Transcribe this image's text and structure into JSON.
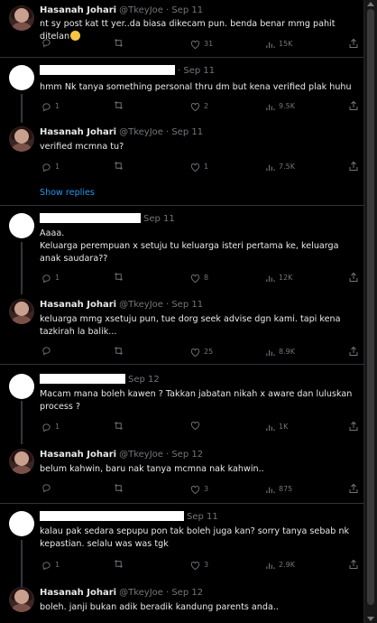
{
  "tweets": [
    {
      "name": "Hasanah Johari",
      "handle": "@TkeyJoe",
      "date": "Sep 11",
      "text": "nt sy post kat tt yer..da biasa dikecam pun. benda benar mmg pahit ditelan",
      "replies": "",
      "retweets": "",
      "likes": "31",
      "views": "15K"
    },
    {
      "name": "",
      "handle": "",
      "date": "Sep 11",
      "text": "hmm Nk tanya something personal  thru dm but kena verified plak huhu",
      "replies": "1",
      "retweets": "",
      "likes": "2",
      "views": "9.5K"
    },
    {
      "name": "Hasanah Johari",
      "handle": "@TkeyJoe",
      "date": "Sep 11",
      "text": "verified mcmna tu?",
      "replies": "1",
      "retweets": "",
      "likes": "1",
      "views": "7.5K"
    },
    {
      "name": "",
      "handle": "",
      "date": "Sep 11",
      "text": "Aaaa.\nKeluarga perempuan x setuju tu keluarga isteri pertama ke, keluarga anak saudara??",
      "replies": "1",
      "retweets": "",
      "likes": "8",
      "views": "12K"
    },
    {
      "name": "Hasanah Johari",
      "handle": "@TkeyJoe",
      "date": "Sep 11",
      "text": "keluarga mmg xsetuju pun, tue dorg seek advise dgn kami. tapi kena tazkirah la balik...",
      "replies": "",
      "retweets": "",
      "likes": "25",
      "views": "8.9K"
    },
    {
      "name": "",
      "handle": "",
      "date": "Sep 12",
      "text": "Macam mana boleh kawen ? Takkan jabatan nikah x aware dan luluskan process ?",
      "replies": "1",
      "retweets": "",
      "likes": "",
      "views": "1K"
    },
    {
      "name": "Hasanah Johari",
      "handle": "@TkeyJoe",
      "date": "Sep 12",
      "text": "belum kahwin, baru nak tanya mcmna nak kahwin..",
      "replies": "",
      "retweets": "",
      "likes": "3",
      "views": "875"
    },
    {
      "name": "",
      "handle": "",
      "date": "Sep 11",
      "text": "kalau pak sedara sepupu pon tak boleh juga kan? sorry tanya sebab nk kepastian. selalu was was tgk",
      "replies": "1",
      "retweets": "",
      "likes": "3",
      "views": "2.9K"
    },
    {
      "name": "Hasanah Johari",
      "handle": "@TkeyJoe",
      "date": "Sep 12",
      "text": "boleh. janji bukan adik beradik kandung parents anda..",
      "replies": "",
      "retweets": "",
      "likes": "",
      "views": ""
    }
  ],
  "show_replies_label": "Show replies",
  "colors": {
    "background": "#000000",
    "text": "#e7e9ea",
    "muted": "#71767b",
    "link": "#1d9bf0"
  }
}
